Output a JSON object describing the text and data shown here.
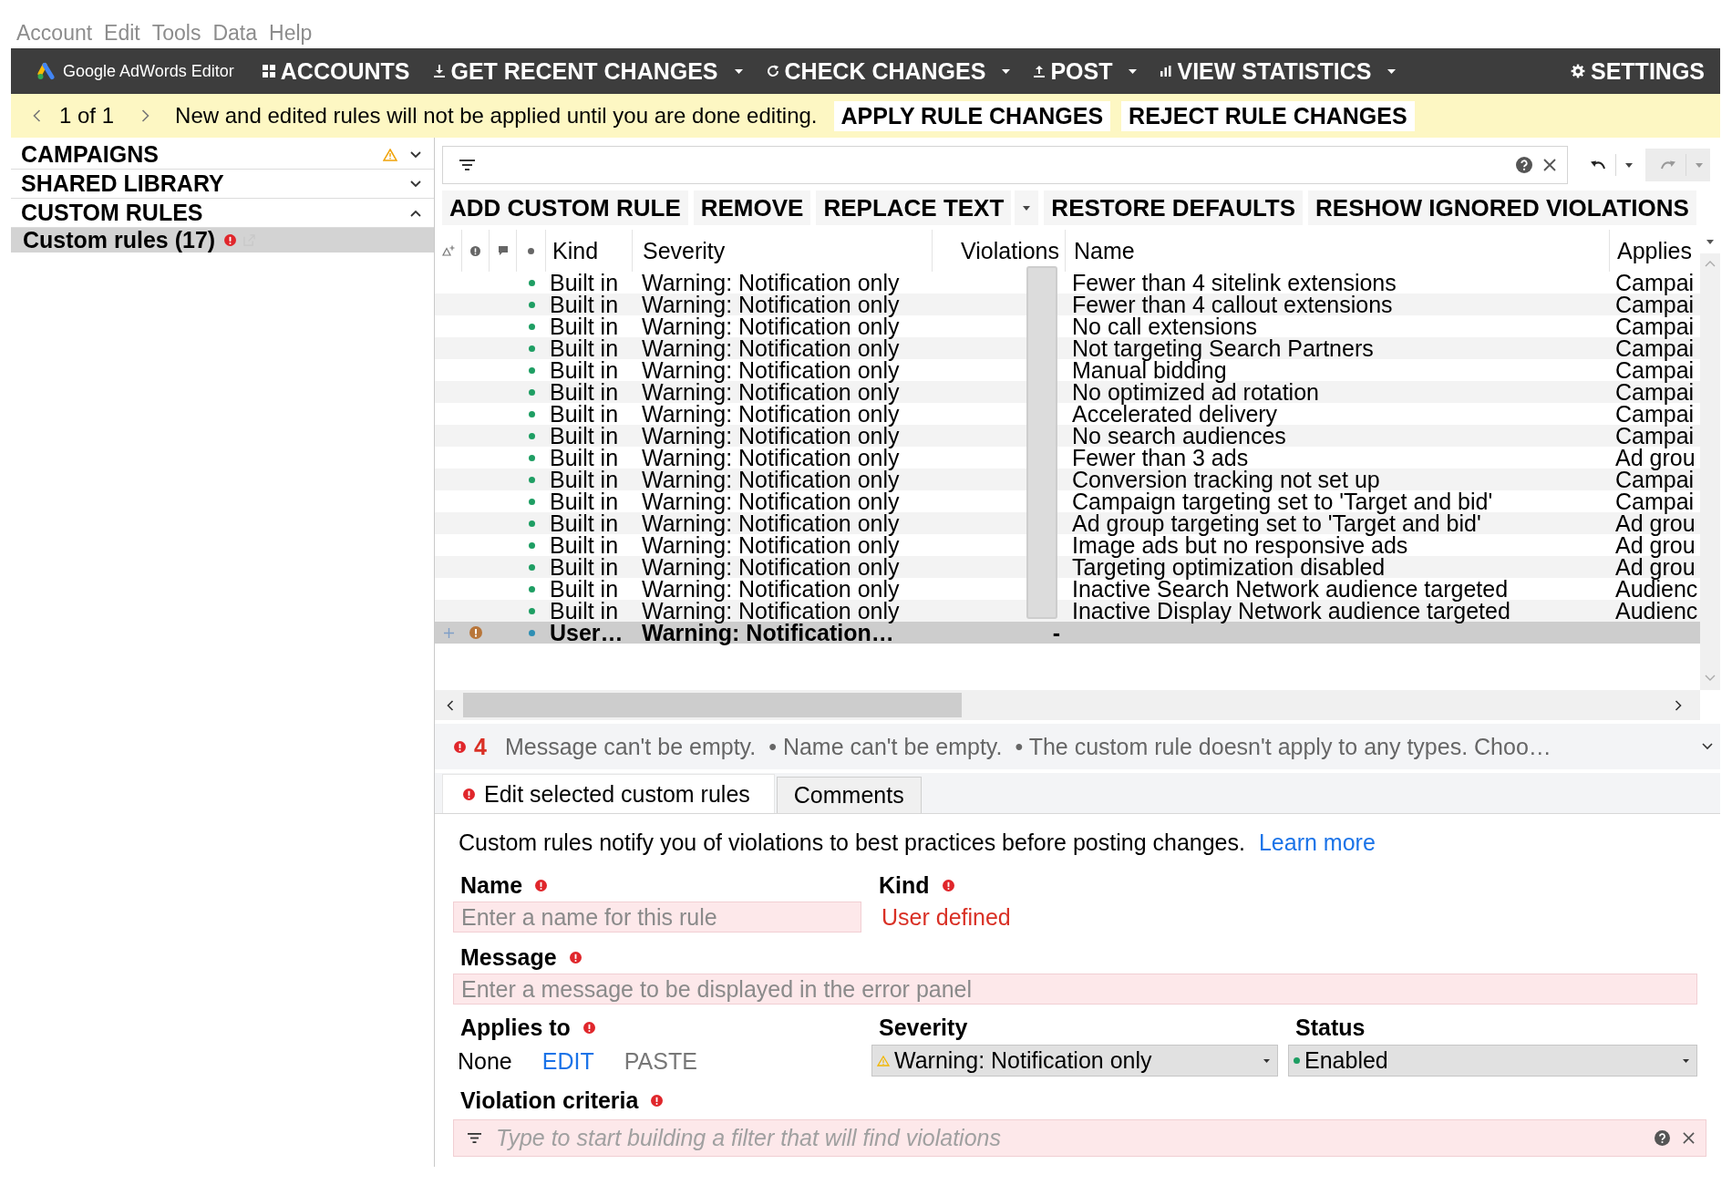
{
  "menu": [
    "Account",
    "Edit",
    "Tools",
    "Data",
    "Help"
  ],
  "toolbar": {
    "app_name": "Google AdWords Editor",
    "buttons": [
      {
        "label": "ACCOUNTS",
        "dropdown": false
      },
      {
        "label": "GET RECENT CHANGES",
        "dropdown": true
      },
      {
        "label": "CHECK CHANGES",
        "dropdown": true
      },
      {
        "label": "POST",
        "dropdown": true
      },
      {
        "label": "VIEW STATISTICS",
        "dropdown": true
      }
    ],
    "settings": "SETTINGS"
  },
  "notice_bar": {
    "pager": "1 of 1",
    "message": "New and edited rules will not be applied until you are done editing.",
    "buttons": [
      "APPLY RULE CHANGES",
      "REJECT RULE CHANGES"
    ]
  },
  "sidebar": {
    "sections": [
      {
        "label": "CAMPAIGNS",
        "warning": true,
        "expanded": false
      },
      {
        "label": "SHARED LIBRARY",
        "warning": false,
        "expanded": false
      },
      {
        "label": "CUSTOM RULES",
        "warning": false,
        "expanded": true,
        "items": [
          {
            "label": "Custom rules (17)",
            "error": true,
            "selected": true
          }
        ]
      }
    ]
  },
  "history": [
    {
      "disabled": false
    },
    {
      "disabled": true
    }
  ],
  "actions": [
    {
      "label": "ADD CUSTOM RULE",
      "dropdown": false
    },
    {
      "label": "REMOVE",
      "dropdown": false
    },
    {
      "label": "REPLACE TEXT",
      "dropdown": true
    },
    {
      "label": "RESTORE DEFAULTS",
      "dropdown": false
    },
    {
      "label": "RESHOW IGNORED VIOLATIONS",
      "dropdown": false
    }
  ],
  "table": {
    "columns": [
      "Kind",
      "Severity",
      "Violations",
      "Name",
      "Applies"
    ],
    "rows": [
      {
        "kind": "Built in",
        "severity": "Warning: Notification only",
        "name": "Fewer than 4 sitelink extensions",
        "applies": "Campai",
        "color": "#1e9e63",
        "new": false,
        "error": false,
        "selected": false
      },
      {
        "kind": "Built in",
        "severity": "Warning: Notification only",
        "name": "Fewer than 4 callout extensions",
        "applies": "Campai",
        "color": "#1e9e63",
        "new": false,
        "error": false,
        "selected": false
      },
      {
        "kind": "Built in",
        "severity": "Warning: Notification only",
        "name": "No call extensions",
        "applies": "Campai",
        "color": "#1e9e63",
        "new": false,
        "error": false,
        "selected": false
      },
      {
        "kind": "Built in",
        "severity": "Warning: Notification only",
        "name": "Not targeting Search Partners",
        "applies": "Campai",
        "color": "#1e9e63",
        "new": false,
        "error": false,
        "selected": false
      },
      {
        "kind": "Built in",
        "severity": "Warning: Notification only",
        "name": "Manual bidding",
        "applies": "Campai",
        "color": "#1e9e63",
        "new": false,
        "error": false,
        "selected": false
      },
      {
        "kind": "Built in",
        "severity": "Warning: Notification only",
        "name": "No optimized ad rotation",
        "applies": "Campai",
        "color": "#1e9e63",
        "new": false,
        "error": false,
        "selected": false
      },
      {
        "kind": "Built in",
        "severity": "Warning: Notification only",
        "name": "Accelerated delivery",
        "applies": "Campai",
        "color": "#1e9e63",
        "new": false,
        "error": false,
        "selected": false
      },
      {
        "kind": "Built in",
        "severity": "Warning: Notification only",
        "name": "No search audiences",
        "applies": "Campai",
        "color": "#1e9e63",
        "new": false,
        "error": false,
        "selected": false
      },
      {
        "kind": "Built in",
        "severity": "Warning: Notification only",
        "name": "Fewer than 3 ads",
        "applies": "Ad grou",
        "color": "#1e9e63",
        "new": false,
        "error": false,
        "selected": false
      },
      {
        "kind": "Built in",
        "severity": "Warning: Notification only",
        "name": "Conversion tracking not set up",
        "applies": "Campai",
        "color": "#1e9e63",
        "new": false,
        "error": false,
        "selected": false
      },
      {
        "kind": "Built in",
        "severity": "Warning: Notification only",
        "name": "Campaign targeting set to 'Target and bid'",
        "applies": "Campai",
        "color": "#1e9e63",
        "new": false,
        "error": false,
        "selected": false
      },
      {
        "kind": "Built in",
        "severity": "Warning: Notification only",
        "name": "Ad group targeting set to 'Target and bid'",
        "applies": "Ad grou",
        "color": "#1e9e63",
        "new": false,
        "error": false,
        "selected": false
      },
      {
        "kind": "Built in",
        "severity": "Warning: Notification only",
        "name": "Image ads but no responsive ads",
        "applies": "Ad grou",
        "color": "#1e9e63",
        "new": false,
        "error": false,
        "selected": false
      },
      {
        "kind": "Built in",
        "severity": "Warning: Notification only",
        "name": "Targeting optimization disabled",
        "applies": "Ad grou",
        "color": "#1e9e63",
        "new": false,
        "error": false,
        "selected": false
      },
      {
        "kind": "Built in",
        "severity": "Warning: Notification only",
        "name": "Inactive Search Network audience targeted",
        "applies": "Audienc",
        "color": "#1e9e63",
        "new": false,
        "error": false,
        "selected": false
      },
      {
        "kind": "Built in",
        "severity": "Warning: Notification only",
        "name": "Inactive Display Network audience targeted",
        "applies": "Audienc",
        "color": "#1e9e63",
        "new": false,
        "error": false,
        "selected": false
      },
      {
        "kind": "User…",
        "severity": "Warning: Notification…",
        "violations": "-",
        "color": "#2e8fb4",
        "new": true,
        "error": true,
        "selected": true
      }
    ]
  },
  "error_bar": {
    "count": "4",
    "messages": [
      "Message can't be empty.",
      "• Name can't be empty.",
      "• The custom rule doesn't apply to any types. Choo…"
    ]
  },
  "tabs": [
    {
      "label": "Edit selected custom rules",
      "error": true,
      "selected": true
    },
    {
      "label": "Comments",
      "error": false,
      "selected": false
    }
  ],
  "form": {
    "description": "Custom rules notify you of violations to best practices before posting changes.",
    "link": "Learn more",
    "name": {
      "label": "Name",
      "error": true,
      "placeholder": "Enter a name for this rule"
    },
    "kind": {
      "label": "Kind",
      "error": true,
      "value": "User defined"
    },
    "message": {
      "label": "Message",
      "error": true,
      "placeholder": "Enter a message to be displayed in the error panel"
    },
    "applies_to": {
      "label": "Applies to",
      "error": true,
      "value": "None",
      "actions": [
        {
          "label": "EDIT",
          "disabled": false
        },
        {
          "label": "PASTE",
          "disabled": true
        }
      ]
    },
    "severity": {
      "label": "Severity",
      "error": false,
      "value": "Warning: Notification only"
    },
    "status": {
      "label": "Status",
      "error": false,
      "value": "Enabled"
    },
    "criteria": {
      "label": "Violation criteria",
      "error": true,
      "placeholder": "Type to start building a filter that will find violations"
    }
  }
}
